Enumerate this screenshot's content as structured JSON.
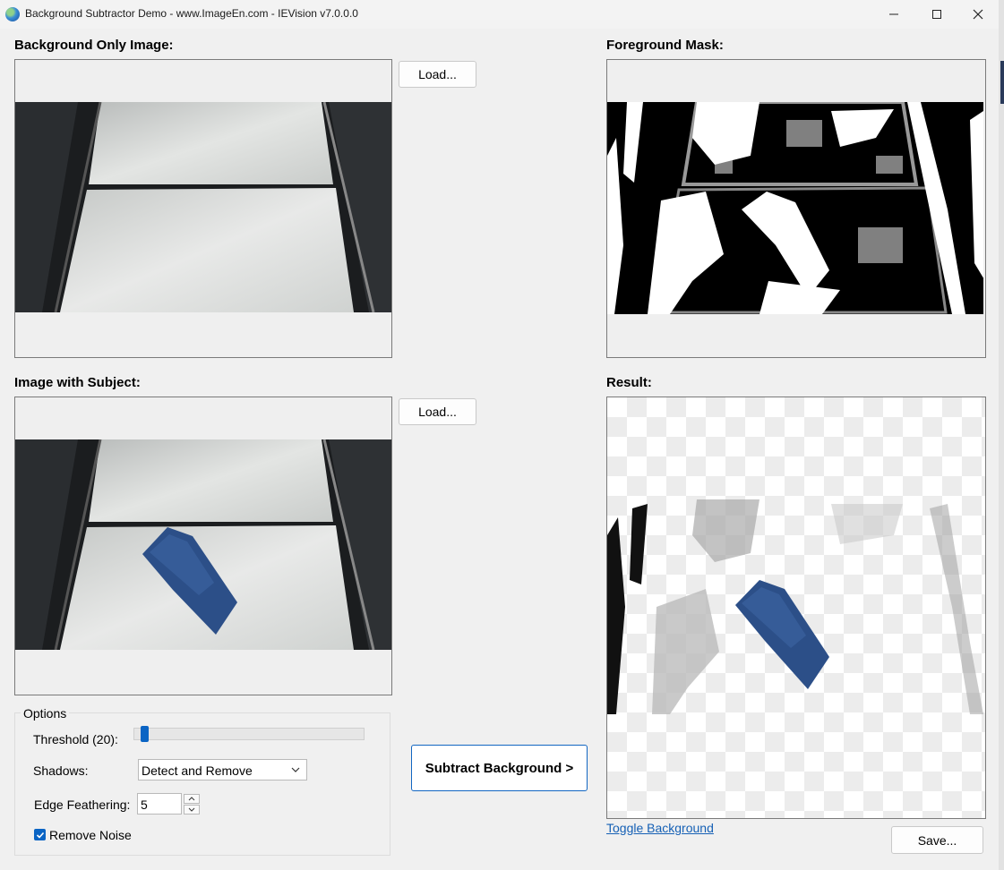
{
  "window": {
    "title": "Background Subtractor Demo - www.ImageEn.com - IEVision v7.0.0.0"
  },
  "panels": {
    "background_only": {
      "heading": "Background Only Image:",
      "load_label": "Load..."
    },
    "with_subject": {
      "heading": "Image with Subject:",
      "load_label": "Load..."
    },
    "foreground_mask": {
      "heading": "Foreground Mask:"
    },
    "result": {
      "heading": "Result:",
      "toggle_label": "Toggle Background",
      "save_label": "Save..."
    }
  },
  "options": {
    "group_title": "Options",
    "threshold_label": "Threshold (20):",
    "threshold_fraction": 0.03,
    "shadows_label": "Shadows:",
    "shadows_value": "Detect and Remove",
    "feather_label": "Edge Feathering:",
    "feather_value": "5",
    "remove_noise_label": "Remove Noise",
    "remove_noise_checked": true
  },
  "actions": {
    "subtract_label": "Subtract Background >"
  },
  "colors": {
    "accent": "#0a64c4",
    "link": "#1560b5",
    "denim": "#2c4f88"
  }
}
